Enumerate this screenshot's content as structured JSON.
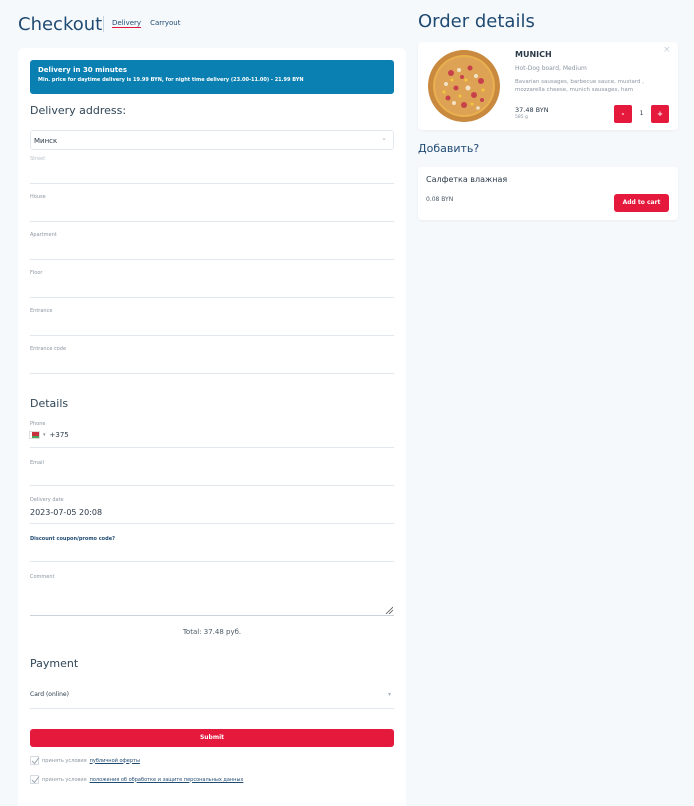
{
  "page": {
    "title": "Checkout",
    "tabs": [
      "Delivery",
      "Carryout"
    ],
    "order_title": "Order details",
    "add_title": "Добавить?"
  },
  "banner": {
    "title": "Delivery in 30 minutes",
    "subtitle": "Min. price for daytime delivery is 19.99 BYN, for night time delivery (23.00-11.00) - 21.99 BYN"
  },
  "address": {
    "heading": "Delivery address:",
    "city": "Минск",
    "fields": [
      "Street",
      "House",
      "Apartment",
      "Floor",
      "Entrance",
      "Entrance code"
    ]
  },
  "details": {
    "heading": "Details",
    "phone_label": "Phone",
    "phone_value": "+375",
    "email_label": "Email",
    "date_label": "Delivery date",
    "date_value": "2023-07-05 20:08",
    "promo_label": "Discount coupon/promo code?",
    "comment_label": "Comment"
  },
  "total": "Total: 37.48 руб.",
  "payment": {
    "heading": "Payment",
    "method": "Card (online)"
  },
  "submit": "Submit",
  "agreements": [
    {
      "prefix": "принять условия ",
      "link": "публичной оферты"
    },
    {
      "prefix": "принять условия ",
      "link": "положения об обработке и защите персональных данных"
    }
  ],
  "order_item": {
    "name": "MUNICH",
    "variant": "Hot-Dog board, Medium",
    "ingredients": "Bavarian sausages, barbecue sauce, mustard , mozzarella cheese, munich sausages, ham",
    "price": "37.48 BYN",
    "weight": "585 g",
    "quantity": "1",
    "minus": "-",
    "plus": "+"
  },
  "addon": {
    "name": "Салфетка влажная",
    "price": "0.08 BYN",
    "button": "Add to cart"
  },
  "colors": {
    "accent": "#e5193c",
    "banner": "#0a7fb1",
    "heading": "#1f4a72"
  }
}
